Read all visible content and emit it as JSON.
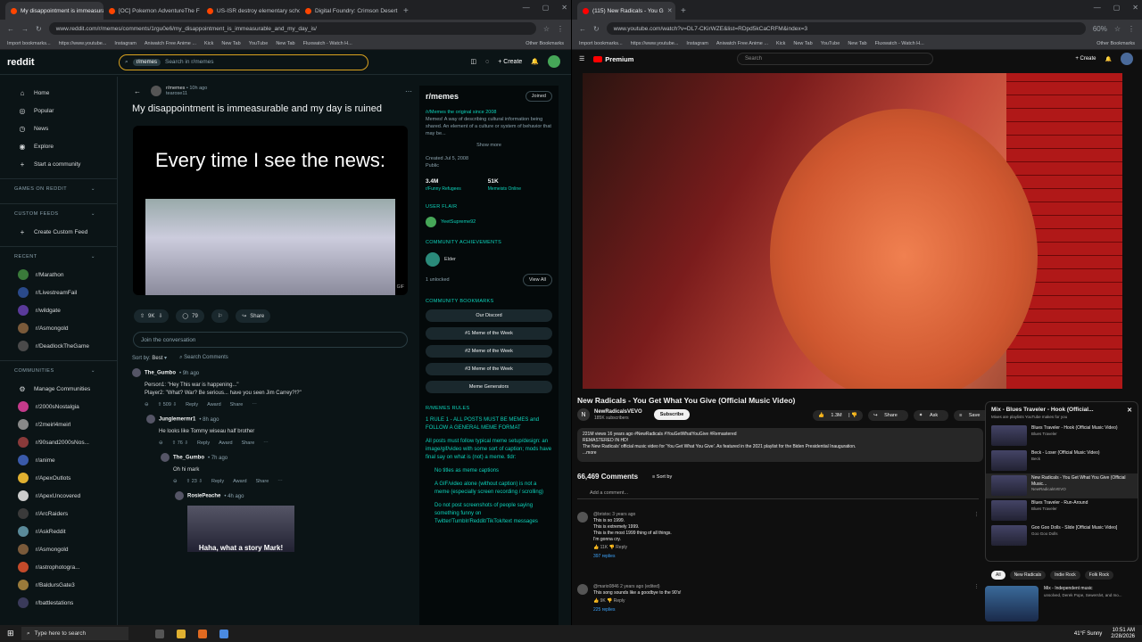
{
  "left_browser": {
    "tabs": [
      {
        "label": "My disappointment is immeasurable",
        "color": "#ff4500",
        "active": true
      },
      {
        "label": "[OC] Pokemon AdventureThe F",
        "color": "#ff4500",
        "active": false
      },
      {
        "label": "US-ISR destroy elementary scho",
        "color": "#ff4500",
        "active": false
      },
      {
        "label": "Digital Foundry: Crimson Desert",
        "color": "#ff4500",
        "active": false
      }
    ],
    "url": "www.reddit.com/r/memes/comments/1rgu0e6/my_disappointment_is_immeasurable_and_my_day_is/",
    "bookmarks": [
      "Import bookmarks...",
      "https://www.youtube...",
      "Instagram",
      "Aniwatch Free Anime ...",
      "Kick",
      "New Tab",
      "YouTube",
      "New Tab",
      "Fluxwatch - Watch H..."
    ],
    "other_bookmarks": "Other Bookmarks"
  },
  "reddit": {
    "logo": "reddit",
    "search_chip": "r/memes",
    "search_placeholder": "Search in r/memes",
    "create_label": "Create",
    "nav": [
      {
        "icon": "home-icon",
        "glyph": "⌂",
        "label": "Home"
      },
      {
        "icon": "popular-icon",
        "glyph": "◎",
        "label": "Popular"
      },
      {
        "icon": "news-icon",
        "glyph": "◷",
        "label": "News"
      },
      {
        "icon": "explore-icon",
        "glyph": "◉",
        "label": "Explore"
      },
      {
        "icon": "plus-icon",
        "glyph": "+",
        "label": "Start a community"
      }
    ],
    "sec_games": "GAMES ON REDDIT",
    "sec_custom": "CUSTOM FEEDS",
    "create_feed": "Create Custom Feed",
    "sec_recent": "RECENT",
    "recent": [
      {
        "label": "r/Marathon",
        "color": "#3a7a3a"
      },
      {
        "label": "r/LivestreamFail",
        "color": "#2a4a8a"
      },
      {
        "label": "r/wildgate",
        "color": "#5a3a9a"
      },
      {
        "label": "r/Asmongold",
        "color": "#7a5a3a"
      },
      {
        "label": "r/DeadlockTheGame",
        "color": "#4a4a4a"
      }
    ],
    "sec_communities": "COMMUNITIES",
    "manage": "Manage Communities",
    "communities": [
      {
        "label": "r/2000sNostalgia",
        "color": "#c43a8a"
      },
      {
        "label": "r/2meirl4meirl",
        "color": "#888888"
      },
      {
        "label": "r/90sand2000sNos...",
        "color": "#8a3a3a"
      },
      {
        "label": "r/anime",
        "color": "#3a5aaa"
      },
      {
        "label": "r/ApexOutlots",
        "color": "#e0b030"
      },
      {
        "label": "r/ApexUncovered",
        "color": "#cccccc"
      },
      {
        "label": "r/ArcRaiders",
        "color": "#3a3a3a"
      },
      {
        "label": "r/AskReddit",
        "color": "#5a8a9a"
      },
      {
        "label": "r/Asmongold",
        "color": "#7a5a3a"
      },
      {
        "label": "r/astrophotogra...",
        "color": "#c44a2a"
      },
      {
        "label": "r/BaldursGate3",
        "color": "#9a7a3a"
      },
      {
        "label": "r/battlestations",
        "color": "#3a3a5a"
      }
    ],
    "post": {
      "sub": "r/memes",
      "age": "• 10h ago",
      "user": "tearose11",
      "title": "My disappointment is immeasurable and my day is ruined",
      "caption": "Every time I see the news:",
      "badge": "GIF",
      "votes": "9K",
      "comments": "79",
      "share": "Share",
      "join": "Join the conversation",
      "sort_label": "Sort by:",
      "sort_value": "Best",
      "search_comments": "Search Comments"
    },
    "comments": [
      {
        "author": "The_Gumbo",
        "age": "• 9h ago",
        "lines": [
          "Person1: \"Hey This war is happening...\"",
          "Player2: \"What? War? Be serious... have you seen Jim Carrey?!?\""
        ],
        "votes": "509",
        "indent": 0
      },
      {
        "author": "Junglemermr1",
        "age": "• 8h ago",
        "lines": [
          "He looks like Tommy wiseau half brother"
        ],
        "votes": "76",
        "indent": 16
      },
      {
        "author": "The_Gumbo",
        "age": "• 7h ago",
        "lines": [
          "Oh hi mark"
        ],
        "votes": "23",
        "indent": 32
      },
      {
        "author": "RosiePeache",
        "age": "• 4h ago",
        "lines": [
          "Haha, what a story Mark!"
        ],
        "votes": "",
        "indent": 48
      }
    ],
    "bar_labels": {
      "reply": "Reply",
      "award": "Award",
      "share": "Share"
    },
    "sidebar": {
      "name": "r/memes",
      "joined": "Joined",
      "tagline": "/r/Memes the original since 2008",
      "desc": "Memes! A way of describing cultural information being shared. An element of a culture or system of behavior that may be...",
      "show_more": "Show more",
      "created": "Created Jul 5, 2008",
      "public": "Public",
      "members": "3.4M",
      "members_label": "r/Funny Refugees",
      "online": "51K",
      "online_label": "Memeists Online",
      "user_flair": "USER FLAIR",
      "flair_user": "YeetSupreme92",
      "achievements": "COMMUNITY ACHIEVEMENTS",
      "achievement": "Elder",
      "unlocked": "1 unlocked",
      "view_all": "View All",
      "bookmarks_h": "COMMUNITY BOOKMARKS",
      "bookmarks": [
        "Our Discord",
        "#1 Meme of the Week",
        "#2 Meme of the Week",
        "#3 Meme of the Week",
        "Meme Generators"
      ],
      "rules_h": "R/MEMES RULES",
      "rule1": "1   RULE 1 - ALL POSTS MUST BE MEMES and FOLLOW A GENERAL MEME FORMAT",
      "rule_body": "All posts must follow typical meme setup/design: an image/gif/video with some sort of caption; mods have final say on what is (not) a meme. tldr:",
      "rule_items": [
        "No titles as meme captions",
        "A GIF/video alone (without caption) is not a meme (especially screen recording / scrolling)",
        "Do not post screenshots of people saying something funny on Twitter/Tumblr/Reddit/TikTok/text messages"
      ]
    }
  },
  "right_browser": {
    "tabs": [
      {
        "label": "(115) New Radicals - You G",
        "color": "#ff0000",
        "active": true
      }
    ],
    "url": "www.youtube.com/watch?v=DL7-CKirWZE&list=RDpd5kCaCRFM&index=3",
    "zoom": "60%",
    "bookmarks": [
      "Import bookmarks...",
      "https://www.youtube...",
      "Instagram",
      "Aniwatch Free Anime ...",
      "Kick",
      "New Tab",
      "YouTube",
      "New Tab",
      "Fluxwatch - Watch H..."
    ],
    "other_bookmarks": "Other Bookmarks"
  },
  "youtube": {
    "logo": "Premium",
    "search_placeholder": "Search",
    "create": "+ Create",
    "video_title": "New Radicals - You Get What You Give (Official Music Video)",
    "channel": "NewRadicalsVEVO",
    "subs": "185K subscribers",
    "subscribe": "Subscribe",
    "likes": "1.3M",
    "share": "Share",
    "ask": "Ask",
    "save": "Save",
    "desc_meta": "221M views  16 years ago  #NewRadicals #YouGetWhatYouGive #Remastered",
    "desc_l1": "REMASTERED IN HD!",
    "desc_l2": "The New Radicals' official music video for 'You Get What You Give'. As featured in the 2021 playlist for the Biden Presidential Inauguration.",
    "desc_more": "...more",
    "comment_count": "66,469 Comments",
    "sort": "Sort by",
    "add_comment": "Add a comment...",
    "comments": [
      {
        "user": "@bristoc  3 years ago",
        "lines": [
          "This is so 1999.",
          "This is extremely 1999.",
          "This is the most 1999 thing of all things.",
          "I'm gonna cry."
        ],
        "likes": "11K",
        "replies": "397 replies"
      },
      {
        "user": "@mario0846  2 years ago (edited)",
        "lines": [
          "This song sounds like a goodbye to the 90's!"
        ],
        "likes": "9K",
        "replies": "225 replies"
      }
    ],
    "mix_title": "Mix - Blues Traveler - Hook (Official...",
    "mix_sub": "Mixes are playlists YouTube makes for you",
    "playlist": [
      {
        "title": "Blues Traveler - Hook (Official Music Video)",
        "channel": "Blues Traveler",
        "current": false
      },
      {
        "title": "Beck - Loser (Official Music Video)",
        "channel": "Beck",
        "current": false
      },
      {
        "title": "New Radicals - You Get What You Give (Official Music...",
        "channel": "NewRadicalsVEVO",
        "current": true
      },
      {
        "title": "Blues Traveler - Run-Around",
        "channel": "Blues Traveler",
        "current": false
      },
      {
        "title": "Goo Goo Dolls - Slide [Official Music Video]",
        "channel": "Goo Goo Dolls",
        "current": false
      }
    ],
    "chips": [
      "All",
      "New Radicals",
      "Indie Rock",
      "Folk Rock"
    ],
    "rec_title": "Mix - Independent music",
    "rec_sub": "unsolved, Derek Pope, Sewerslvt, and mo..."
  },
  "taskbar": {
    "search": "Type here to search",
    "weather": "41°F  Sunny",
    "time": "10:51 AM",
    "date": "2/28/2026"
  }
}
